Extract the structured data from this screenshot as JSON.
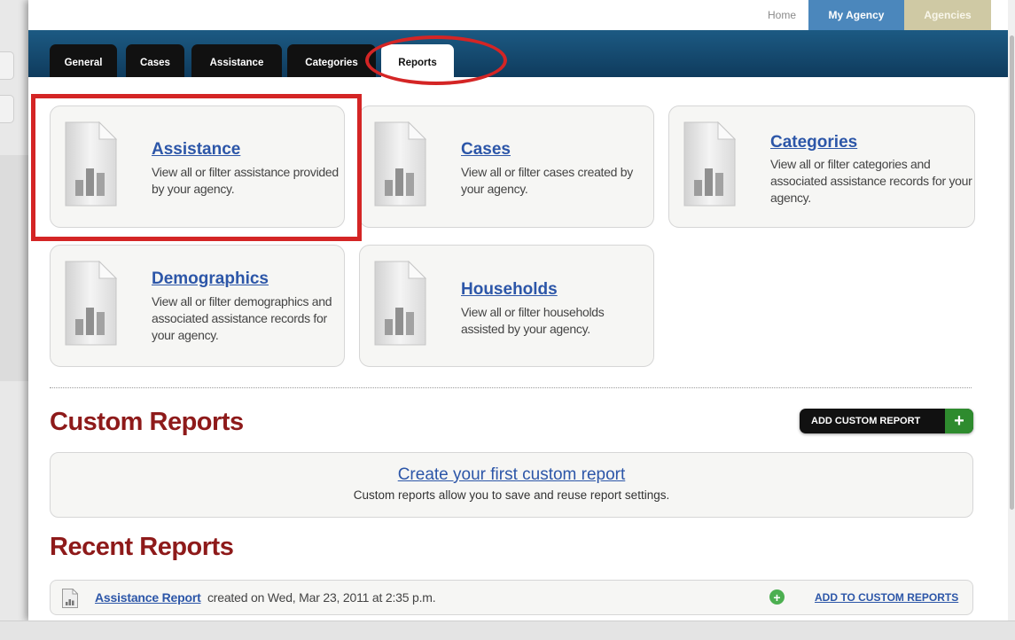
{
  "top_nav": {
    "home": "Home",
    "my_agency": "My Agency",
    "agencies": "Agencies"
  },
  "tabs": [
    "General",
    "Cases",
    "Assistance",
    "Categories",
    "Reports"
  ],
  "active_tab": "Reports",
  "report_cards": [
    {
      "title": "Assistance",
      "description": "View all or filter assistance provided by your agency."
    },
    {
      "title": "Cases",
      "description": "View all or filter cases created by your agency."
    },
    {
      "title": "Categories",
      "description": "View all or filter categories and associated assistance records for your agency."
    },
    {
      "title": "Demographics",
      "description": "View all or filter demographics and associated assistance records for your agency."
    },
    {
      "title": "Households",
      "description": "View all or filter households assisted by your agency."
    }
  ],
  "custom_reports": {
    "heading": "Custom Reports",
    "add_button": "ADD CUSTOM REPORT",
    "add_symbol": "+",
    "create_link": "Create your first custom report",
    "description": "Custom reports allow you to save and reuse report settings."
  },
  "recent_reports": {
    "heading": "Recent Reports",
    "items": [
      {
        "name": "Assistance Report",
        "meta": "created on Wed, Mar 23, 2011 at 2:35 p.m.",
        "action": "ADD TO CUSTOM REPORTS",
        "action_symbol": "+"
      }
    ]
  },
  "colors": {
    "link": "#2c56a8",
    "heading": "#8e1a1a",
    "highlight": "#d42525",
    "tabbar": "#1c5a83",
    "add_green": "#2e8b2e"
  }
}
